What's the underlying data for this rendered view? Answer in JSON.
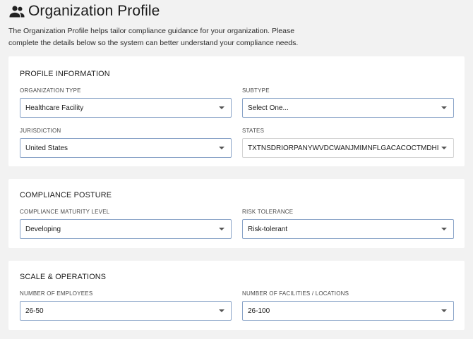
{
  "header": {
    "title": "Organization Profile",
    "icon": "people-icon",
    "intro": "The Organization Profile helps tailor compliance guidance for your organization. Please complete the details below so the system can better understand your compliance needs."
  },
  "sections": {
    "profile": {
      "title": "PROFILE INFORMATION",
      "org_type": {
        "label": "ORGANIZATION TYPE",
        "value": "Healthcare Facility"
      },
      "subtype": {
        "label": "SUBTYPE",
        "value": "Select One..."
      },
      "jurisdiction": {
        "label": "JURISDICTION",
        "value": "United States"
      },
      "states": {
        "label": "STATES",
        "value": "TXTNSDRIORPANYWVDCWANJMIMNFLGACACOCTMDHI"
      }
    },
    "posture": {
      "title": "COMPLIANCE POSTURE",
      "maturity": {
        "label": "COMPLIANCE MATURITY LEVEL",
        "value": "Developing"
      },
      "risk": {
        "label": "RISK TOLERANCE",
        "value": "Risk-tolerant"
      }
    },
    "scale": {
      "title": "SCALE & OPERATIONS",
      "employees": {
        "label": "NUMBER OF EMPLOYEES",
        "value": "26-50"
      },
      "facilities": {
        "label": "NUMBER OF FACILITIES / LOCATIONS",
        "value": "26-100"
      }
    }
  },
  "colors": {
    "background": "#f2f2f2",
    "card": "#ffffff",
    "field_border": "#8aa4c8"
  }
}
